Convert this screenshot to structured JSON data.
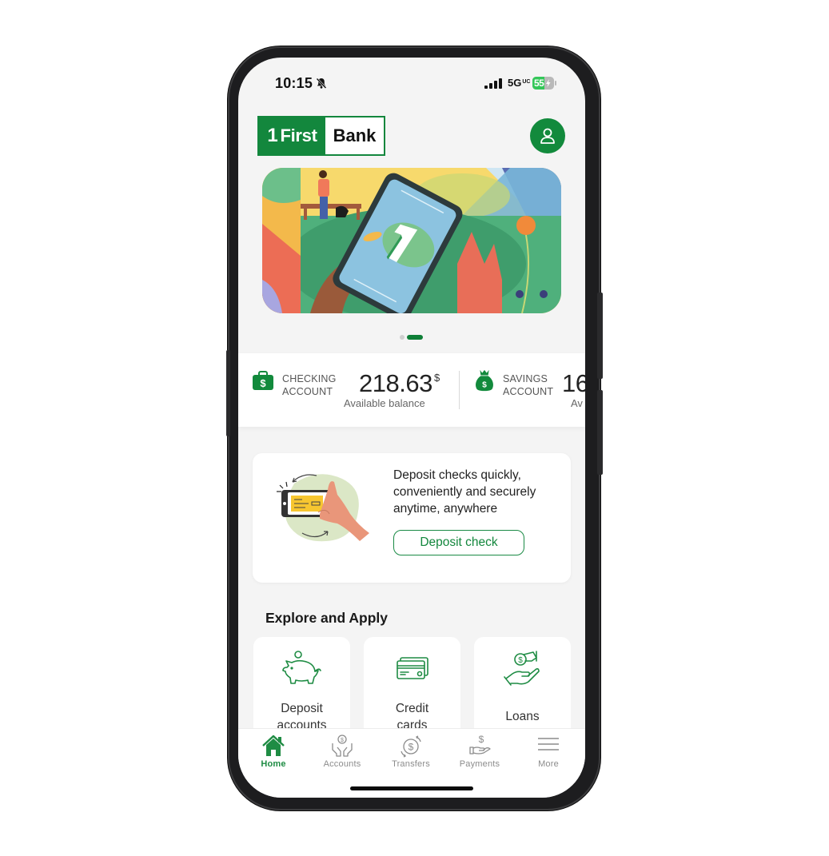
{
  "status_bar": {
    "time": "10:15",
    "network": "5G",
    "network_sub": "UC",
    "battery": "55",
    "icons": [
      "bell-slash-icon",
      "cellular-signal-icon",
      "battery-charging-icon"
    ]
  },
  "header": {
    "logo_left": "First",
    "logo_digit": "1",
    "logo_right": "Bank",
    "profile_icon": "user-icon"
  },
  "banner": {
    "slides_total": 2,
    "active_slide": 2
  },
  "accounts": [
    {
      "name_line1": "CHECKING",
      "name_line2": "ACCOUNT",
      "amount": "218.63",
      "currency": "$",
      "balance_label": "Available balance",
      "icon": "briefcase-dollar-icon"
    },
    {
      "name_line1": "SAVINGS",
      "name_line2": "ACCOUNT",
      "amount": "16",
      "currency": "",
      "balance_label": "Av",
      "icon": "money-bag-icon"
    }
  ],
  "deposit_card": {
    "text": "Deposit checks quickly, conveniently and securely anytime, anywhere",
    "button": "Deposit check"
  },
  "explore": {
    "title": "Explore and Apply",
    "tiles": [
      {
        "label_line1": "Deposit",
        "label_line2": "accounts",
        "icon": "piggy-bank-icon"
      },
      {
        "label_line1": "Credit",
        "label_line2": "cards",
        "icon": "credit-card-icon"
      },
      {
        "label_line1": "Loans",
        "label_line2": "",
        "icon": "hand-coin-icon"
      }
    ]
  },
  "bottom_nav": {
    "items": [
      {
        "label": "Home",
        "icon": "home-icon",
        "active": true
      },
      {
        "label": "Accounts",
        "icon": "accounts-icon",
        "active": false
      },
      {
        "label": "Transfers",
        "icon": "transfers-icon",
        "active": false
      },
      {
        "label": "Payments",
        "icon": "payments-icon",
        "active": false
      },
      {
        "label": "More",
        "icon": "menu-icon",
        "active": false
      }
    ]
  },
  "colors": {
    "brand_green": "#13873d",
    "background": "#f4f4f4",
    "battery_green": "#34c759"
  }
}
